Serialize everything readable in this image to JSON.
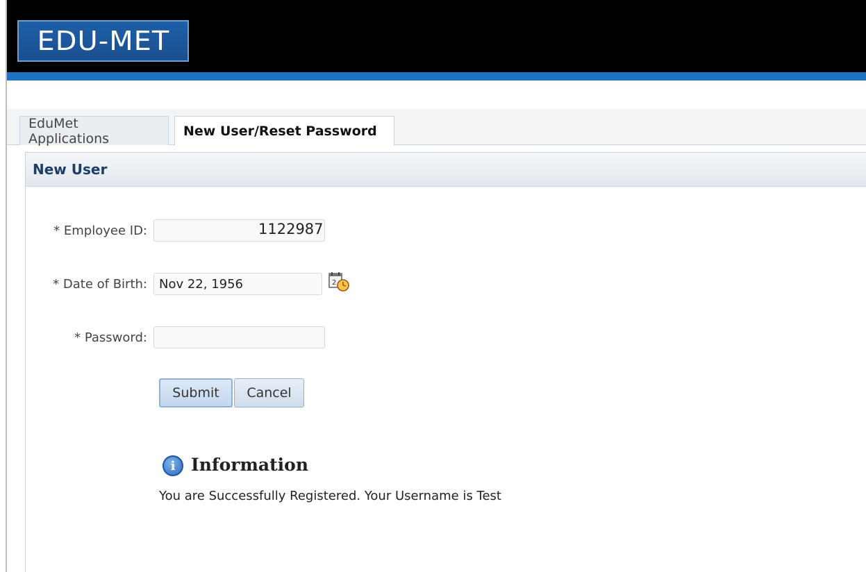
{
  "header": {
    "logo_text": "EDU-MET"
  },
  "tabs": [
    {
      "label": "EduMet Applications",
      "active": false
    },
    {
      "label": "New User/Reset Password",
      "active": true
    }
  ],
  "panel": {
    "title": "New User"
  },
  "form": {
    "employee_id": {
      "label": "* Employee ID:",
      "value": "1122987"
    },
    "date_of_birth": {
      "label": "* Date of Birth:",
      "value": "Nov 22, 1956"
    },
    "password": {
      "label": "* Password:",
      "value": ""
    }
  },
  "buttons": {
    "submit": "Submit",
    "cancel": "Cancel"
  },
  "info": {
    "icon_glyph": "i",
    "title": "Information",
    "message": "You are Successfully Registered. Your Username is Test"
  },
  "colors": {
    "header_bg": "#000000",
    "header_bar": "#1f73bf",
    "logo_bg": "#1e5fa8",
    "panel_title": "#1c3d66"
  }
}
